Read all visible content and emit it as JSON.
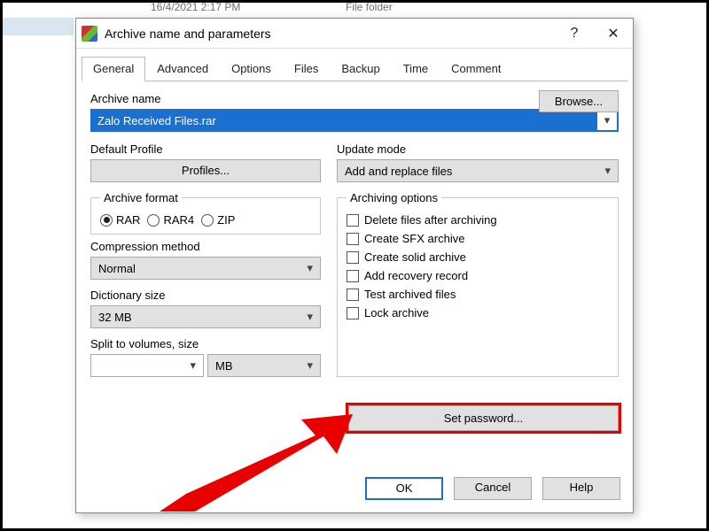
{
  "background": {
    "date": "16/4/2021 2:17 PM",
    "file_type": "File folder"
  },
  "dialog": {
    "title": "Archive name and parameters",
    "help_glyph": "?",
    "close_glyph": "✕",
    "tabs": [
      "General",
      "Advanced",
      "Options",
      "Files",
      "Backup",
      "Time",
      "Comment"
    ],
    "archive_name_label": "Archive name",
    "browse_label": "Browse...",
    "archive_name_value": "Zalo Received Files.rar",
    "default_profile_label": "Default Profile",
    "profiles_button": "Profiles...",
    "update_mode_label": "Update mode",
    "update_mode_value": "Add and replace files",
    "archive_format_label": "Archive format",
    "archive_format_options": [
      "RAR",
      "RAR4",
      "ZIP"
    ],
    "archive_format_selected": "RAR",
    "compression_method_label": "Compression method",
    "compression_method_value": "Normal",
    "dictionary_size_label": "Dictionary size",
    "dictionary_size_value": "32 MB",
    "split_label": "Split to volumes, size",
    "split_value": "",
    "split_unit": "MB",
    "archiving_options_label": "Archiving options",
    "archiving_options": [
      "Delete files after archiving",
      "Create SFX archive",
      "Create solid archive",
      "Add recovery record",
      "Test archived files",
      "Lock archive"
    ],
    "set_password_label": "Set password...",
    "ok_label": "OK",
    "cancel_label": "Cancel",
    "help_label": "Help"
  },
  "annotation": {
    "color": "#e80000"
  }
}
